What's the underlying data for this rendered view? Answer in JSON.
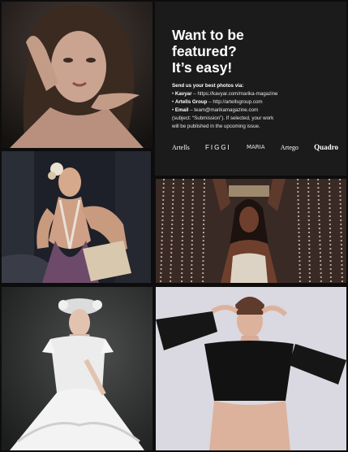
{
  "headline": {
    "line1": "Want to be",
    "line2": "featured?",
    "line3": "It’s easy!"
  },
  "submission": {
    "intro": "Send us your best photos via:",
    "kavyar_label": "Kavyar",
    "kavyar_value": "– https://kavyar.com/marika-magazine",
    "artells_label": "Artells Group",
    "artells_value": "– http://artellsgroup.com",
    "email_label": "Email",
    "email_value": "– team@marikamagazine.com",
    "note_line1": "(subject: “Submission”). If selected, your work",
    "note_line2": "will be published in the upcoming issue."
  },
  "partner_logos": [
    "Artells",
    "FIGGI",
    "MARIA",
    "Artego",
    "Quadro"
  ],
  "colors": {
    "page_background": "#0d0d0d",
    "panel_background": "#1b1b1b",
    "text": "#ffffff"
  }
}
